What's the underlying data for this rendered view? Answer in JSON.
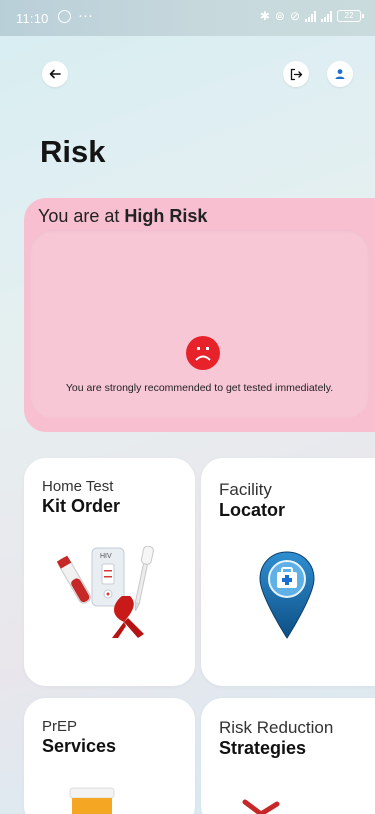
{
  "status_bar": {
    "time": "11:10",
    "battery": "22"
  },
  "header": {
    "back_icon": "arrow-left-icon",
    "logout_icon": "logout-icon",
    "profile_icon": "user-icon"
  },
  "page": {
    "title": "Risk"
  },
  "risk": {
    "prefix": "You are at ",
    "level": "High Risk",
    "message": "You are strongly recommended to get tested immediately.",
    "accent": "#e8222b",
    "card_bg": "#f7bfd0"
  },
  "tiles": {
    "home_test": {
      "line1": "Home Test",
      "line2": "Kit Order",
      "kit_label": "HIV"
    },
    "facility": {
      "line1": "Facility",
      "line2": "Locator"
    },
    "prep": {
      "line1": "PrEP",
      "line2": "Services"
    },
    "risk_reduction": {
      "line1": "Risk Reduction",
      "line2": "Strategies"
    }
  }
}
